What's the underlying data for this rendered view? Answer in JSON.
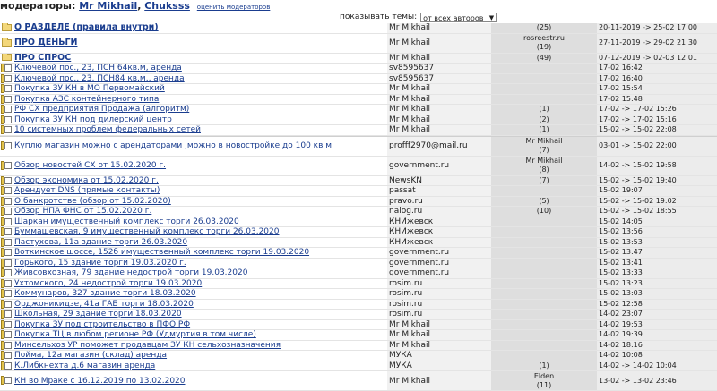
{
  "moderators": {
    "label": "модераторы:",
    "names": [
      "Mr Mikhail",
      "Chuksss"
    ],
    "rate_link": "оценить модераторов"
  },
  "filter": {
    "label": "показывать темы:",
    "selected": "от всех авторов"
  },
  "topics": [
    {
      "title": "О РАЗДЕЛЕ (правила внутри)",
      "author": "Mr Mikhail",
      "count": "(25)",
      "date": "20-11-2019 -> 25-02 17:00",
      "bold": true,
      "icon": "folder"
    },
    {
      "title": "ПРО ДЕНЬГИ",
      "author": "Mr Mikhail",
      "count": "rosreestr.ru\n(19)",
      "date": "27-11-2019 -> 29-02 21:30",
      "bold": true,
      "icon": "folder",
      "tall": true
    },
    {
      "title": "ПРО СПРОС",
      "author": "Mr Mikhail",
      "count": "(49)",
      "date": "07-12-2019 -> 02-03 12:01",
      "bold": true,
      "icon": "folder"
    },
    {
      "title": "Ключевой пос., 23, ПСН 64кв.м, аренда",
      "author": "sv8595637",
      "count": "",
      "date": "17-02 16:42",
      "icon": "lock"
    },
    {
      "title": "Ключевой пос., 23, ПСН84 кв.м., аренда",
      "author": "sv8595637",
      "count": "",
      "date": "17-02 16:40",
      "icon": "lock"
    },
    {
      "title": "Покупка ЗУ КН в МО Первомайский",
      "author": "Mr Mikhail",
      "count": "",
      "date": "17-02 15:54",
      "icon": "lock"
    },
    {
      "title": "Покупка АЗС контейнерного типа",
      "author": "Mr Mikhail",
      "count": "",
      "date": "17-02 15:48",
      "icon": "lock"
    },
    {
      "title": "РФ СХ предприятия Продажа (алгоритм)",
      "author": "Mr Mikhail",
      "count": "(1)",
      "date": "17-02 -> 17-02 15:26",
      "icon": "lock"
    },
    {
      "title": "Покупка ЗУ КН под дилерский центр",
      "author": "Mr Mikhail",
      "count": "(2)",
      "date": "17-02 -> 17-02 15:16",
      "icon": "lock"
    },
    {
      "title": "10 системных проблем федеральных сетей",
      "author": "Mr Mikhail",
      "count": "(1)",
      "date": "15-02 -> 15-02 22:08",
      "icon": "lock"
    },
    {
      "sep": true
    },
    {
      "title": "Куплю магазин можно с арендаторами ,можно в новостройке до 100 кв м",
      "author": "profff2970@mail.ru",
      "count": "Mr Mikhail\n(7)",
      "date": "03-01 -> 15-02 22:00",
      "icon": "doc",
      "tall": true
    },
    {
      "title": "Обзор новостей СХ от 15.02.2020 г.",
      "author": "government.ru",
      "count": "Mr Mikhail\n(8)",
      "date": "14-02 -> 15-02 19:58",
      "icon": "doc",
      "tall": true
    },
    {
      "title": "Обзор экономика от 15.02.2020 г.",
      "author": "NewsKN",
      "count": "(7)",
      "date": "15-02 -> 15-02 19:40",
      "icon": "doc"
    },
    {
      "title": "Арендует DNS (прямые контакты)",
      "author": "passat",
      "count": "",
      "date": "15-02 19:07",
      "icon": "doc"
    },
    {
      "title": "О банкротстве (обзор от 15.02.2020)",
      "author": "pravo.ru",
      "count": "(5)",
      "date": "15-02 -> 15-02 19:02",
      "icon": "doc"
    },
    {
      "title": "Обзор НПА ФНС от 15.02.2020 г.",
      "author": "nalog.ru",
      "count": "(10)",
      "date": "15-02 -> 15-02 18:55",
      "icon": "doc"
    },
    {
      "title": "Шаркан имущественный комплекс торги 26.03.2020",
      "author": "КНИжевск",
      "count": "",
      "date": "15-02 14:05",
      "icon": "doc"
    },
    {
      "title": "Буммашевская, 9 имущественный комплекс торги 26.03.2020",
      "author": "КНИжевск",
      "count": "",
      "date": "15-02 13:56",
      "icon": "doc"
    },
    {
      "title": "Пастухова, 11а здание торги 26.03.2020",
      "author": "КНИжевск",
      "count": "",
      "date": "15-02 13:53",
      "icon": "doc"
    },
    {
      "title": "Воткинское шоссе, 152б имущественный комплекс торги 19.03.2020",
      "author": "government.ru",
      "count": "",
      "date": "15-02 13:47",
      "icon": "doc"
    },
    {
      "title": "Горького, 15 здание торги 19.03.2020 г.",
      "author": "government.ru",
      "count": "",
      "date": "15-02 13:41",
      "icon": "doc"
    },
    {
      "title": "Живсовхозная, 79 здание недострой торги 19.03.2020",
      "author": "government.ru",
      "count": "",
      "date": "15-02 13:33",
      "icon": "doc"
    },
    {
      "title": "Ухтомского, 24 недострой торги 19.03.2020",
      "author": "rosim.ru",
      "count": "",
      "date": "15-02 13:23",
      "icon": "doc"
    },
    {
      "title": "Коммунаров, 327 здание торги 18.03.2020",
      "author": "rosim.ru",
      "count": "",
      "date": "15-02 13:03",
      "icon": "doc"
    },
    {
      "title": "Орджоникидзе, 41а ГАБ торги 18.03.2020",
      "author": "rosim.ru",
      "count": "",
      "date": "15-02 12:58",
      "icon": "doc"
    },
    {
      "title": "Школьная, 29 здание торги 18.03.2020",
      "author": "rosim.ru",
      "count": "",
      "date": "14-02 23:07",
      "icon": "doc"
    },
    {
      "title": "Покупка ЗУ под строительство в ПФО РФ",
      "author": "Mr Mikhail",
      "count": "",
      "date": "14-02 19:53",
      "icon": "doc"
    },
    {
      "title": "Покупка ТЦ в любом регионе РФ (Удмуртия в том числе)",
      "author": "Mr Mikhail",
      "count": "",
      "date": "14-02 19:39",
      "icon": "doc"
    },
    {
      "title": "Минсельхоз УР поможет продавцам ЗУ КН сельхозназначения",
      "author": "Mr Mikhail",
      "count": "",
      "date": "14-02 18:16",
      "icon": "doc"
    },
    {
      "title": "Пойма, 12а магазин (склад) аренда",
      "author": "МУКА",
      "count": "",
      "date": "14-02 10:08",
      "icon": "doc"
    },
    {
      "title": "К.Либкнехта д.6 магазин аренда",
      "author": "МУКА",
      "count": "(1)",
      "date": "14-02 -> 14-02 10:04",
      "icon": "doc"
    },
    {
      "title": "КН во Мраке с 16.12.2019 по 13.02.2020",
      "author": "Mr Mikhail",
      "count": "Elden\n(11)",
      "date": "13-02 -> 13-02 23:46",
      "icon": "doc",
      "tall": true
    }
  ]
}
